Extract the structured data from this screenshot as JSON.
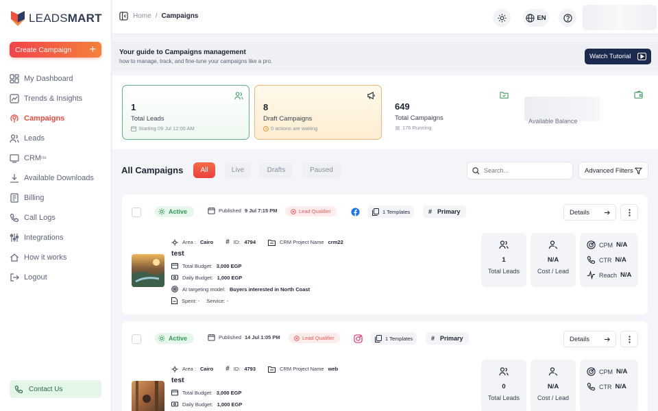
{
  "brand": {
    "name_light": "LEADS",
    "name_bold": "MART",
    "primary": "#ee4a3e",
    "navy": "#1c2a4f"
  },
  "sidebar": {
    "create_label": "Create Campaign",
    "items": [
      {
        "label": "My Dashboard",
        "icon": "dashboard-icon"
      },
      {
        "label": "Trends & Insights",
        "icon": "trends-icon"
      },
      {
        "label": "Campaigns",
        "icon": "campaigns-icon",
        "active": true
      },
      {
        "label": "Leads",
        "icon": "leads-icon"
      },
      {
        "label": "CRM",
        "sub": "lite",
        "icon": "crm-icon"
      },
      {
        "label": "Available Downloads",
        "icon": "download-icon"
      },
      {
        "label": "Billing",
        "icon": "billing-icon"
      },
      {
        "label": "Call Logs",
        "icon": "call-logs-icon"
      },
      {
        "label": "Integrations",
        "icon": "integrations-icon"
      },
      {
        "label": "How it works",
        "icon": "home-icon"
      },
      {
        "label": "Logout",
        "icon": "logout-icon"
      }
    ],
    "contact_label": "Contact Us"
  },
  "topbar": {
    "breadcrumb_home": "Home",
    "breadcrumb_sep": "/",
    "breadcrumb_current": "Campaigns",
    "lang": "EN"
  },
  "guide": {
    "title": "Your guide to Campaigns management",
    "subtitle": "how to manage, track, and fine-tune your campaigns like a pro.",
    "button": "Watch Tutorial"
  },
  "stats": [
    {
      "value": "1",
      "label": "Total Leads",
      "sub": "Starting 09 Jul 12:00 AM"
    },
    {
      "value": "8",
      "label": "Draft Campaigns",
      "sub": "0 actions are waiting"
    },
    {
      "value": "649",
      "label": "Total Campaigns",
      "sub": "176 Running"
    }
  ],
  "balance_label": "Available Balance",
  "list": {
    "title": "All Campaigns",
    "filters": [
      "All",
      "Live",
      "Drafts",
      "Paused"
    ],
    "search_placeholder": "Search...",
    "advanced_filters": "Advanced Filters"
  },
  "campaigns": [
    {
      "status": "Active",
      "published_prefix": "Published",
      "published_date": "9 Jul 7:15 PM",
      "qualifier": "Lead Qualifier",
      "platform": "facebook",
      "templates": "1 Templates",
      "tag": "Primary",
      "details": "Details",
      "area_label": "Area :",
      "area": "Cairo",
      "id_label": "ID:",
      "id": "4794",
      "crm_label": "CRM Project Name",
      "crm": "crm22",
      "name": "test",
      "total_budget_label": "Total Budget:",
      "total_budget": "3,000 EGP",
      "daily_budget_label": "Daily Budget:",
      "daily_budget": "1,000 EGP",
      "ai_label": "AI targeting model:",
      "ai": "Buyers interested in North Coast",
      "spent_label": "Spent: -",
      "service_label": "Service: -",
      "leads_value": "1",
      "leads_label": "Total Leads",
      "cpl_value": "N/A",
      "cpl_label": "Cost / Lead",
      "cpm_label": "CPM",
      "cpm": "N/A",
      "ctr_label": "CTR",
      "ctr": "N/A",
      "reach_label": "Reach",
      "reach": "N/A"
    },
    {
      "status": "Active",
      "published_prefix": "Published",
      "published_date": "14 Jul 1:05 PM",
      "qualifier": "Lead Qualifier",
      "platform": "instagram",
      "templates": "1 Templates",
      "tag": "Primary",
      "details": "Details",
      "area_label": "Area :",
      "area": "Cairo",
      "id_label": "ID:",
      "id": "4793",
      "crm_label": "CRM Project Name",
      "crm": "web",
      "name": "test",
      "total_budget_label": "Total Budget:",
      "total_budget": "3,000 EGP",
      "daily_budget_label": "Daily Budget:",
      "daily_budget": "1,000 EGP",
      "leads_value": "0",
      "leads_label": "Total Leads",
      "cpl_value": "N/A",
      "cpl_label": "Cost / Lead",
      "cpm_label": "CPM",
      "cpm": "N/A",
      "ctr_label": "CTR",
      "ctr": "N/A"
    }
  ]
}
